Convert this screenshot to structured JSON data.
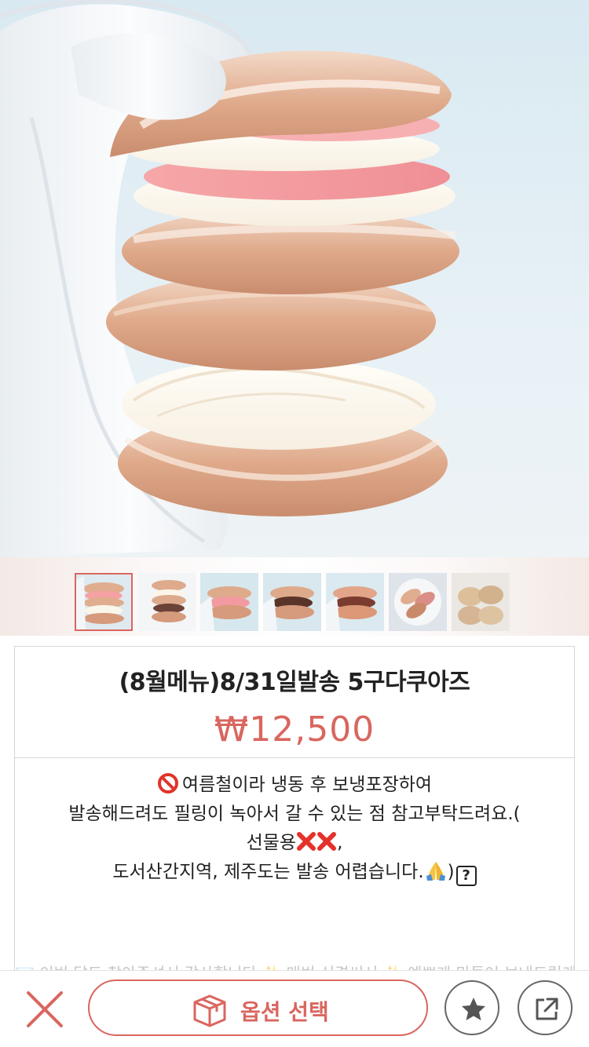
{
  "product": {
    "title": "(8월메뉴)8/31일발송 5구다쿠아즈",
    "price": "₩12,500"
  },
  "description": {
    "line1": "여름철이라 냉동 후 보냉포장하여",
    "line2": "발송해드려도  필링이 녹아서 갈 수 있는 점 참고부탁드려요.(",
    "line3_prefix": "선물용",
    "line3_suffix": ",",
    "line4_text": "도서산간지역, 제주도는 발송 어렵습니다.",
    "line4_close": ")",
    "question_mark": "?",
    "cut_text": "💌 이번 달도 찾아주셔서 감사합니다 ✨ 매번 신경써서 ✨ 예쁘게 만들어 보내드릴게요"
  },
  "thumbnails": [
    {
      "name": "thumb-1",
      "selected": true
    },
    {
      "name": "thumb-2",
      "selected": false
    },
    {
      "name": "thumb-3",
      "selected": false
    },
    {
      "name": "thumb-4",
      "selected": false
    },
    {
      "name": "thumb-5",
      "selected": false
    },
    {
      "name": "thumb-6",
      "selected": false
    },
    {
      "name": "thumb-7",
      "selected": false
    }
  ],
  "bottom_bar": {
    "option_label": "옵션 선택",
    "close_icon": "close-icon",
    "box_icon": "box-icon",
    "star_icon": "star-icon",
    "share_icon": "share-icon"
  },
  "colors": {
    "accent": "#d9665f",
    "text": "#222222",
    "border": "#d7d7d7"
  }
}
